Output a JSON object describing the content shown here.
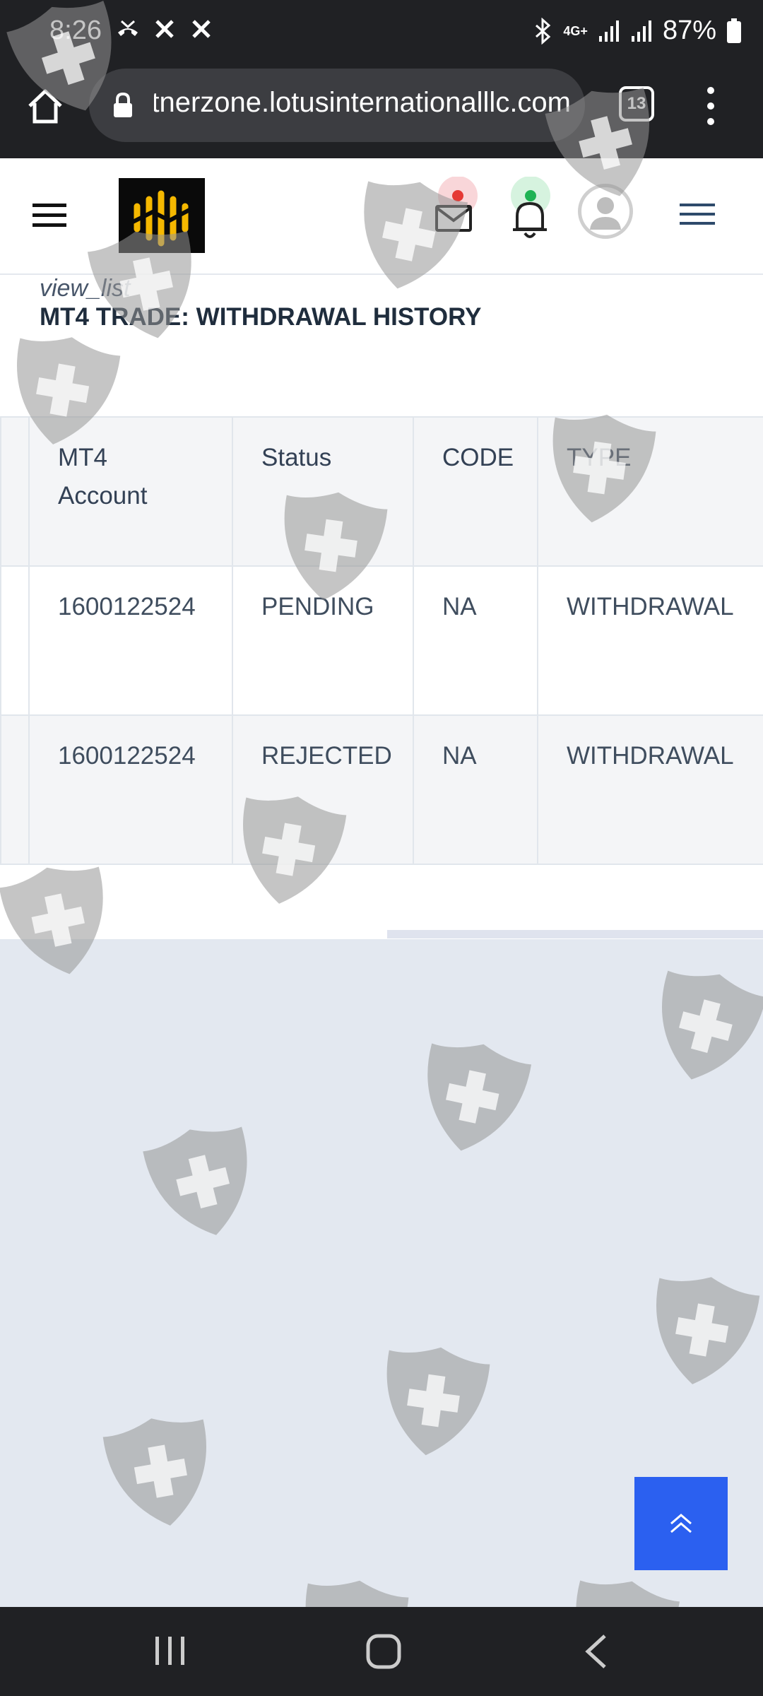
{
  "status_bar": {
    "time": "8:26",
    "network": "4G+",
    "battery": "87%",
    "icons": [
      "missed-call-icon",
      "wifi-calling-off-icon",
      "wifi-calling-off-icon",
      "bluetooth-icon",
      "signal-icon",
      "signal-icon",
      "battery-icon"
    ]
  },
  "browser": {
    "url": "partnerzone.lotusinternationalllc.com",
    "tab_count": "13"
  },
  "header": {
    "logo": "logo",
    "mail_badge_color": "#e53935",
    "bell_badge_color": "#1fb354"
  },
  "page": {
    "view_label": "view_list",
    "title": "MT4 TRADE: WITHDRAWAL HISTORY"
  },
  "table": {
    "headers": [
      "MT4 Account",
      "Status",
      "CODE",
      "TYPE"
    ],
    "rows": [
      [
        "1600122524",
        "PENDING",
        "NA",
        "WITHDRAWAL"
      ],
      [
        "1600122524",
        "REJECTED",
        "NA",
        "WITHDRAWAL"
      ]
    ]
  },
  "colors": {
    "accent": "#2b60f0",
    "page_background": "#e3e8f0",
    "system_bars": "#202124"
  }
}
